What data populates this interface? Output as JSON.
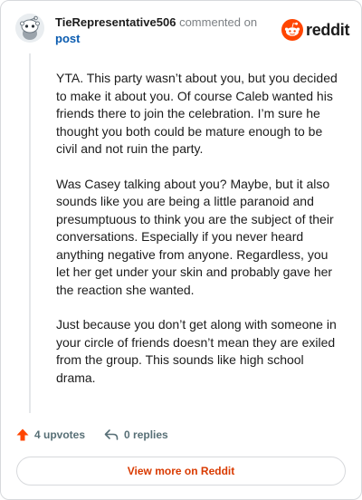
{
  "comment": {
    "author": "TieRepresentative506",
    "action_text": "commented on",
    "post_link": "post",
    "paragraphs": [
      "YTA. This party wasn’t about you, but you decided to make it about you. Of course Caleb wanted his friends there to join the celebration. I’m sure he thought you both could be mature enough to be civil and not ruin the party.",
      "Was Casey talking about you? Maybe, but it also sounds like you are being a little paranoid and presumptuous to think you are the subject of their conversations. Especially if you never heard anything negative from anyone. Regardless, you let her get under your skin and probably gave her the reaction she wanted.",
      "Just because you don’t get along with someone in your circle of friends doesn’t mean they are exiled from the group. This sounds like high school drama."
    ],
    "upvotes_label": "4 upvotes",
    "replies_label": "0 replies"
  },
  "brand": {
    "name": "reddit",
    "color": "#ff4500"
  },
  "footer": {
    "view_more_label": "View more on Reddit"
  },
  "icons": {
    "avatar": "snoo-avatar-icon",
    "logo": "reddit-logo-icon",
    "upvote": "upvote-arrow-icon",
    "reply": "reply-arrow-icon"
  }
}
